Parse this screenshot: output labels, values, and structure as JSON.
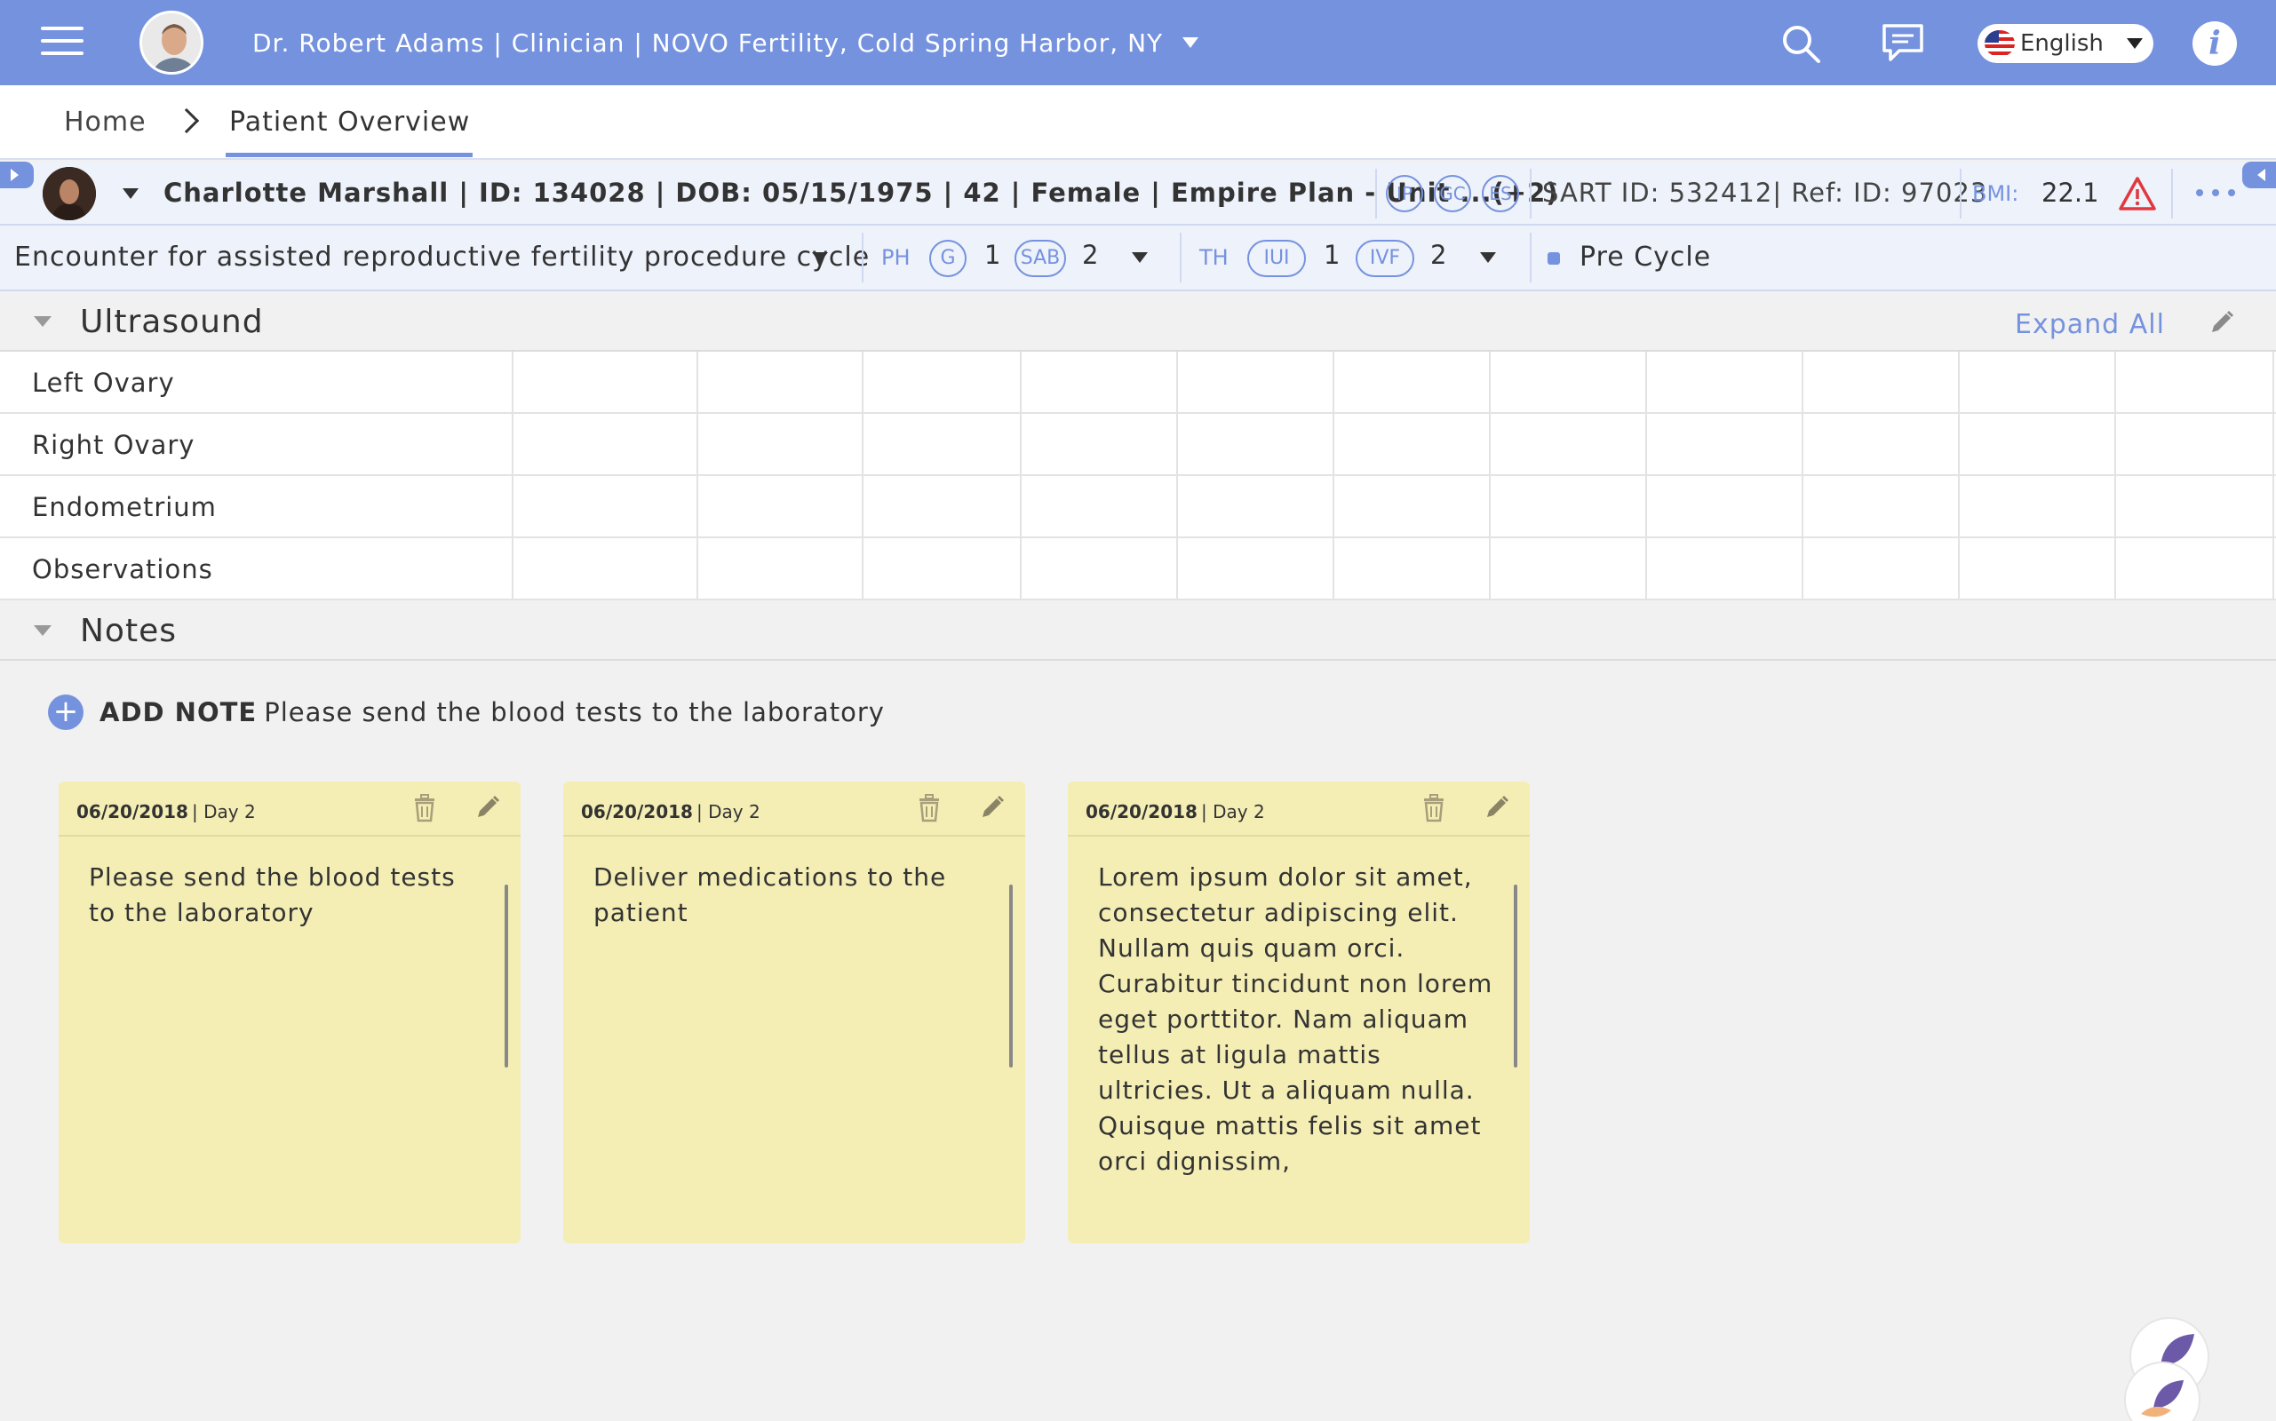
{
  "header": {
    "user_info": "Dr. Robert Adams | Clinician | NOVO Fertility, Cold Spring Harbor, NY",
    "language": "English"
  },
  "breadcrumb": {
    "home": "Home",
    "current": "Patient Overview"
  },
  "patient": {
    "summary": "Charlotte Marshall | ID: 134028 | DOB: 05/15/1975 | 42 | Female | Empire Plan - Unit ...(+2)",
    "badges": [
      "IP",
      "GC",
      "ES"
    ],
    "ids": "SART ID: 532412| Ref: ID: 97023",
    "bmi_label": "BMI:",
    "bmi_value": "22.1"
  },
  "encounter": {
    "description": "Encounter for assisted reproductive fertility procedure cycle",
    "ph_label": "PH",
    "ph_items": [
      {
        "label": "G",
        "count": "1"
      },
      {
        "label": "SAB",
        "count": "2"
      }
    ],
    "th_label": "TH",
    "th_items": [
      {
        "label": "IUI",
        "count": "1"
      },
      {
        "label": "IVF",
        "count": "2"
      }
    ],
    "status": "Pre Cycle"
  },
  "ultrasound": {
    "title": "Ultrasound",
    "expand_all": "Expand All",
    "rows": [
      "Left Ovary",
      "Right Ovary",
      "Endometrium",
      "Observations"
    ]
  },
  "notes": {
    "title": "Notes",
    "add_label": "ADD NOTE",
    "add_text": "Please send the blood tests to the laboratory",
    "cards": [
      {
        "date": "06/20/2018",
        "day": "|  Day 2",
        "text": "Please send the blood tests to the laboratory"
      },
      {
        "date": "06/20/2018",
        "day": "|  Day 2",
        "text": "Deliver medications to the patient"
      },
      {
        "date": "06/20/2018",
        "day": "|  Day 2",
        "text": "Lorem ipsum dolor sit amet, consectetur adipiscing elit. Nullam quis quam orci. Curabitur tincidunt non lorem eget porttitor. Nam aliquam tellus at ligula mattis ultricies. Ut a aliquam nulla. Quisque mattis felis sit amet orci dignissim,"
      }
    ]
  },
  "colors": {
    "accent": "#7592de",
    "note_bg": "#f4eeb5",
    "warning": "#e0383e"
  }
}
